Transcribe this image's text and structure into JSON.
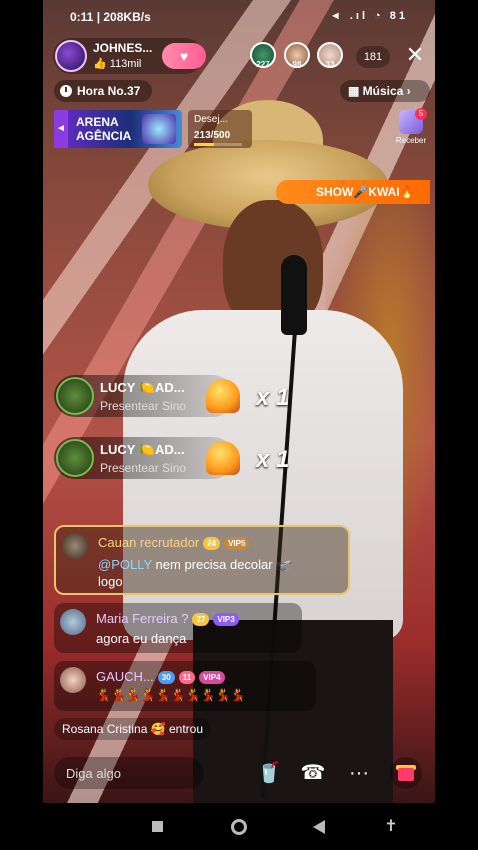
{
  "status_bar": {
    "time_speed": "0:11 | 208KB/s",
    "right_icons": "◄ .ıl ◔ 81"
  },
  "host": {
    "name": "JOHNES...",
    "likes": "113mil",
    "follow_label": "♥"
  },
  "viewers": [
    {
      "badge": "227",
      "color": "#2da36a"
    },
    {
      "badge": "98",
      "color": "#5a7ad8"
    },
    {
      "badge": "33",
      "color": "#d8a13a"
    }
  ],
  "viewer_count": "181",
  "close_label": "✕",
  "hour": {
    "label": "Hora No.37"
  },
  "music": {
    "label": "Música",
    "icon": "grid-icon",
    "arrow": "›"
  },
  "arena": {
    "tab": "◄",
    "line1": "ARENA",
    "line2": "AGÊNCIA"
  },
  "wish": {
    "title": "Desej...",
    "progress_text": "213/500",
    "progress_value": 0.426
  },
  "receive": {
    "label": "Receber",
    "badge": "5"
  },
  "show_banner": {
    "text": "SHOW🎤KWAI🔥"
  },
  "gifts": [
    {
      "name": "LUCY 🍋AD...",
      "subtitle": "Presentear Sino",
      "count": "x 1"
    },
    {
      "name": "LUCY 🍋AD...",
      "subtitle": "Presentear Sino",
      "count": "x 1"
    }
  ],
  "chat": [
    {
      "name": "Cauan recrutador",
      "badges": [
        "24",
        "VIP5"
      ],
      "mention": "@POLLY",
      "text": "nem precisa decolar 🛫",
      "text2": "logo",
      "highlight": true
    },
    {
      "name": "Maria Ferreira ?",
      "badges": [
        "27",
        "VIP3"
      ],
      "text": "agora eu dança",
      "highlight": false
    },
    {
      "name": "GAUCH...",
      "badges": [
        "30",
        "11",
        "VIP4"
      ],
      "text": "💃💃💃💃💃💃💃💃💃💃",
      "highlight": false
    }
  ],
  "entered": {
    "name": "Rosana Cristina",
    "suffix": "🥰 entrou"
  },
  "input": {
    "placeholder": "Diga algo"
  },
  "bottom": {
    "more": "···",
    "call": "☎"
  },
  "colors": {
    "accent_orange": "#ff7a10",
    "vip_purple": "#8b5cf6",
    "level_yellow": "#f5c542"
  }
}
